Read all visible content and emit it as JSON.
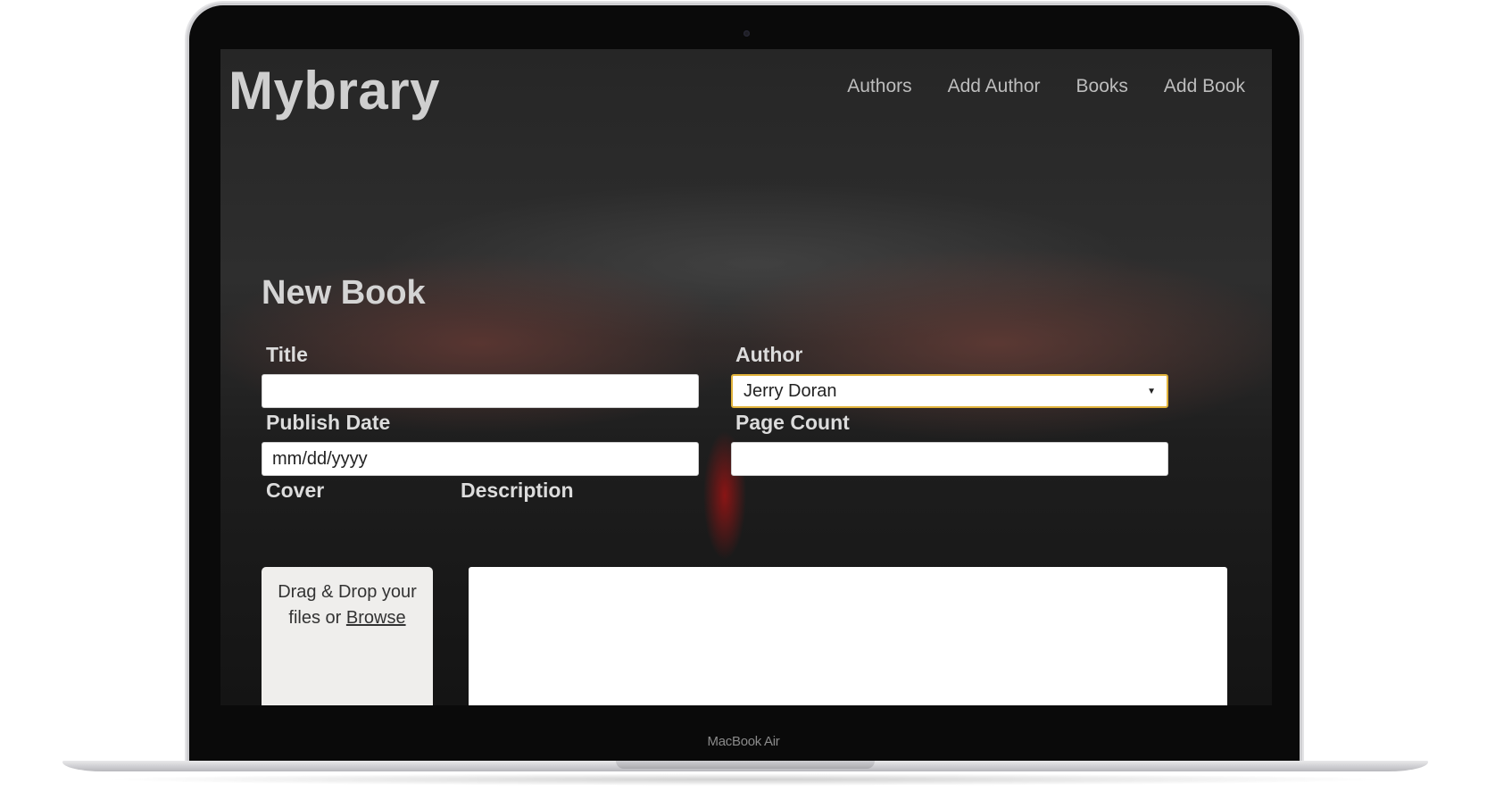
{
  "device": {
    "label": "MacBook Air"
  },
  "app": {
    "logo": "Mybrary",
    "nav": [
      {
        "label": "Authors"
      },
      {
        "label": "Add Author"
      },
      {
        "label": "Books"
      },
      {
        "label": "Add Book"
      }
    ]
  },
  "form": {
    "title": "New Book",
    "fields": {
      "title": {
        "label": "Title",
        "value": ""
      },
      "author": {
        "label": "Author",
        "selected": "Jerry Doran"
      },
      "publish_date": {
        "label": "Publish Date",
        "placeholder": "mm/dd/yyyy"
      },
      "page_count": {
        "label": "Page Count",
        "value": ""
      },
      "cover": {
        "label": "Cover",
        "drop_text": "Drag & Drop your files or",
        "browse_label": "Browse"
      },
      "description": {
        "label": "Description",
        "value": ""
      }
    }
  },
  "colors": {
    "focus_border": "#e0b23a",
    "text_light": "#dcdcdc",
    "nav_text": "#bdbdbd"
  }
}
